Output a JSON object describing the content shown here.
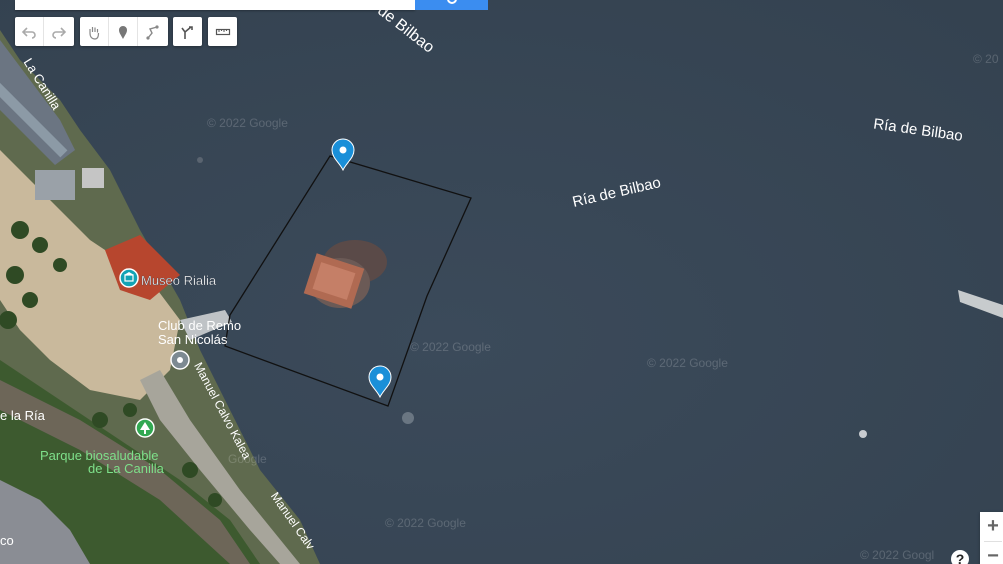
{
  "map": {
    "water_labels": [
      "Ría de Bilbao",
      "Ría de Bilbao",
      "Ría de Bilbao"
    ],
    "pois": {
      "museo": "Museo Rialia",
      "club_line1": "Club de Remo",
      "club_line2": "San Nicolás",
      "park_line1": "Parque biosaludable",
      "park_line2": "de La Canilla"
    },
    "streets": {
      "canilla": "La Canilla",
      "manuel_calvo": "Manuel Calvo Kalea",
      "manuel_calvo_2": "Manuel Calv",
      "de_la_ria": "e la Ría",
      "edge_co": "co"
    },
    "watermark": "© 2022 Google",
    "partial_watermark": "© 2022 Googl",
    "partial_g": "Google",
    "partial_top": "© 20"
  },
  "toolbar": {
    "icons": [
      "undo-icon",
      "redo-icon",
      "hand-icon",
      "marker-icon",
      "line-icon",
      "route-icon",
      "ruler-icon"
    ]
  },
  "controls": {
    "zoom_in": "+",
    "zoom_out": "−",
    "help": "?"
  },
  "colors": {
    "water": "#3a4858",
    "marker": "#1a8fd8",
    "polygon_stroke": "#111111"
  }
}
